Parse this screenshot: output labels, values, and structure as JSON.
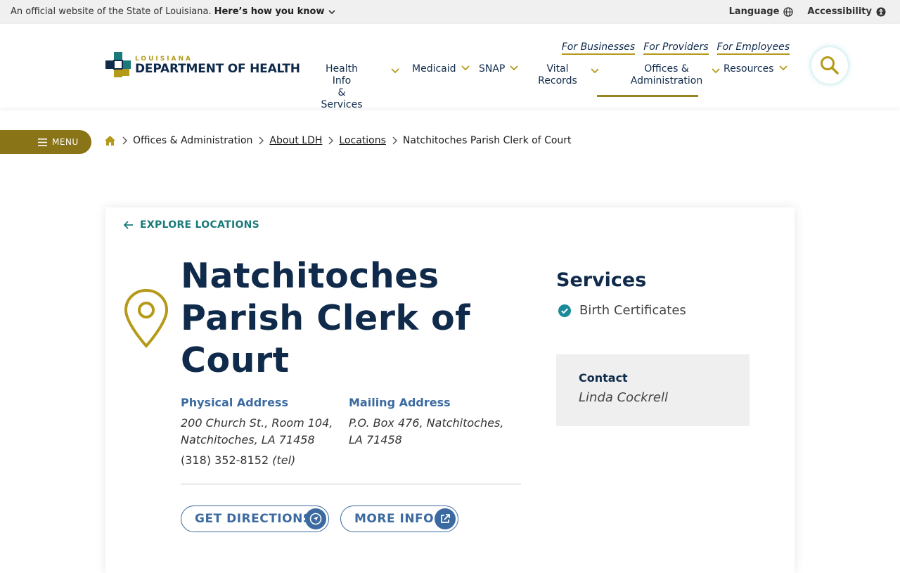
{
  "gov_banner": {
    "text": "An official website of the State of Louisiana.",
    "how_you_know": "Here’s how you know",
    "language": "Language",
    "accessibility": "Accessibility"
  },
  "logo": {
    "small": "LOUISIANA",
    "big": "DEPARTMENT OF HEALTH"
  },
  "util_links": [
    "For Businesses",
    "For Providers",
    "For Employees"
  ],
  "nav": [
    {
      "line1": "Health Info",
      "line2": "& Services"
    },
    {
      "line1": "Medicaid",
      "line2": ""
    },
    {
      "line1": "SNAP",
      "line2": ""
    },
    {
      "line1": "Vital",
      "line2": "Records"
    },
    {
      "line1": "Offices &",
      "line2": "Administration"
    },
    {
      "line1": "Resources",
      "line2": ""
    }
  ],
  "menu_label": "MENU",
  "breadcrumb": [
    "Offices & Administration",
    "About LDH",
    "Locations",
    "Natchitoches Parish Clerk of Court"
  ],
  "location": {
    "back_link": "EXPLORE LOCATIONS",
    "title": "Natchitoches Parish Clerk of Court",
    "physical_label": "Physical Address",
    "physical_line1": "200 Church St., Room 104,",
    "physical_line2": "Natchitoches, LA 71458",
    "phone": "(318) 352-8152",
    "phone_type": "(tel)",
    "mailing_label": "Mailing Address",
    "mailing_line1": "P.O. Box 476, Natchitoches,",
    "mailing_line2": "LA 71458",
    "btn_directions": "GET DIRECTIONS",
    "btn_more": "MORE INFO",
    "services_heading": "Services",
    "services": [
      "Birth Certificates"
    ],
    "contact_heading": "Contact",
    "contact_name": "Linda Cockrell"
  },
  "colors": {
    "navy": "#0f2a4a",
    "gold": "#b59a1a",
    "teal": "#1a7a7a",
    "blue": "#3b6aa0"
  }
}
